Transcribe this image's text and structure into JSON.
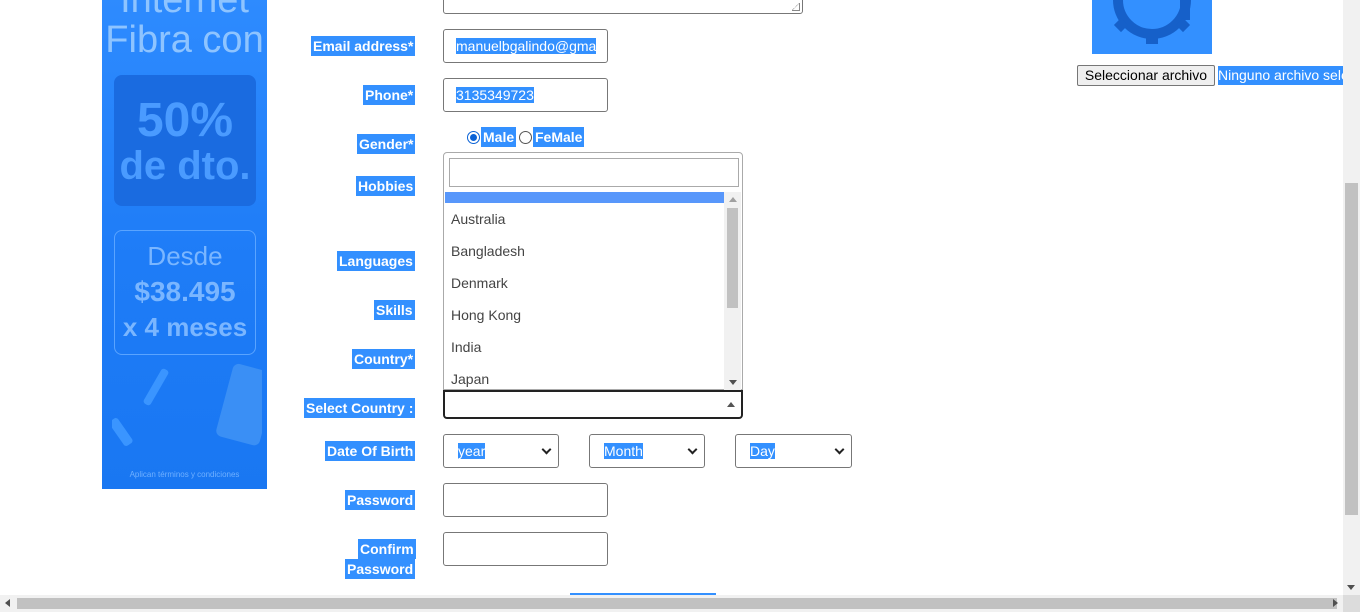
{
  "ad": {
    "headline_1": "Internet",
    "headline_2": "Fibra con",
    "discount_1": "50%",
    "discount_2": "de dto.",
    "price_1": "Desde",
    "price_2": "$38.495",
    "price_3": "x 4 meses",
    "footnote": "Aplican términos y condiciones"
  },
  "form": {
    "email": {
      "label": "Email address*",
      "value": "manuelbgalindo@gma"
    },
    "phone": {
      "label": "Phone*",
      "value": "3135349723"
    },
    "gender": {
      "label": "Gender*",
      "options": [
        "Male",
        "FeMale"
      ],
      "selected": "Male"
    },
    "hobbies": {
      "label": "Hobbies"
    },
    "languages": {
      "label": "Languages"
    },
    "skills": {
      "label": "Skills"
    },
    "country": {
      "label": "Country*",
      "search_value": "",
      "options": [
        "Australia",
        "Bangladesh",
        "Denmark",
        "Hong Kong",
        "India",
        "Japan"
      ]
    },
    "select_country": {
      "label": "Select Country :",
      "value": ""
    },
    "dob": {
      "label": "Date Of Birth",
      "year": "year",
      "month": "Month",
      "day": "Day"
    },
    "password": {
      "label": "Password",
      "value": ""
    },
    "confirm_password": {
      "label_1": "Confirm",
      "label_2": "Password",
      "value": ""
    }
  },
  "file": {
    "button_label": "Seleccionar archivo",
    "status": "Ninguno archivo seleccionado"
  },
  "colors": {
    "selection": "#3390ff",
    "ad_blue": "#1e7cf7",
    "dropdown_highlight": "#5897fb"
  }
}
